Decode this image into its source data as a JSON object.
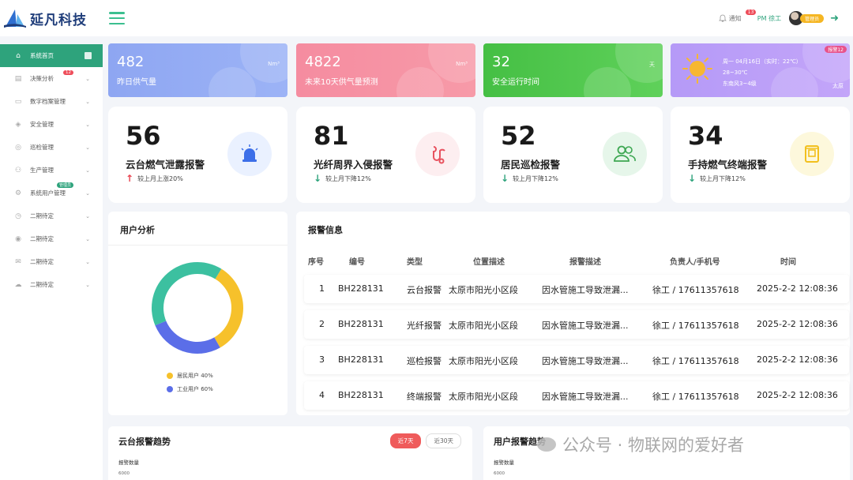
{
  "brand": {
    "name": "延凡科技"
  },
  "header": {
    "notify_label": "通知",
    "notify_count": "13",
    "role": "PM 徐工",
    "user_badge": "管理员"
  },
  "sidebar": {
    "items": [
      {
        "label": "系统首页",
        "icon": "home-icon"
      },
      {
        "label": "决策分析",
        "icon": "chart-icon",
        "count": "12"
      },
      {
        "label": "数字档案管理",
        "icon": "archive-icon"
      },
      {
        "label": "安全管理",
        "icon": "shield-icon"
      },
      {
        "label": "巡检管理",
        "icon": "search-icon"
      },
      {
        "label": "生产管理",
        "icon": "people-icon"
      },
      {
        "label": "系统用户管理",
        "icon": "settings-icon",
        "tag": "管理员"
      },
      {
        "label": "二期待定",
        "icon": "clock-icon"
      },
      {
        "label": "二期待定",
        "icon": "target-icon"
      },
      {
        "label": "二期待定",
        "icon": "mail-icon"
      },
      {
        "label": "二期待定",
        "icon": "cloud-icon"
      }
    ]
  },
  "stats": [
    {
      "value": "482",
      "label": "昨日供气量",
      "unit": "Nm³"
    },
    {
      "value": "4822",
      "label": "未来10天供气量预测",
      "unit": "Nm³"
    },
    {
      "value": "32",
      "label": "安全运行时间",
      "unit": "天"
    }
  ],
  "weather": {
    "line1": "周一 04月16日（实时：22℃）",
    "line2": "28~30℃",
    "line3": "东南风3~4级",
    "city": "太原",
    "badge": "报警12"
  },
  "alarms": [
    {
      "value": "56",
      "name": "云台燃气泄露报警",
      "trend": "较上月上涨20%",
      "dir": "up",
      "icon": "siren-icon"
    },
    {
      "value": "81",
      "name": "光纤周界入侵报警",
      "trend": "较上月下降12%",
      "dir": "down",
      "icon": "fiber-icon"
    },
    {
      "value": "52",
      "name": "居民巡检报警",
      "trend": "较上月下降12%",
      "dir": "down",
      "icon": "users-icon"
    },
    {
      "value": "34",
      "name": "手持燃气终端报警",
      "trend": "较上月下降12%",
      "dir": "down",
      "icon": "terminal-icon"
    }
  ],
  "user_analysis": {
    "title": "用户分析",
    "legend": [
      "居民用户 40%",
      "工业用户 60%"
    ]
  },
  "alarm_table": {
    "title": "报警信息",
    "columns": [
      "序号",
      "编号",
      "类型",
      "位置描述",
      "报警描述",
      "负责人/手机号",
      "时间"
    ],
    "rows": [
      [
        "1",
        "BH228131",
        "云台报警",
        "太原市阳光小区段",
        "因水管施工导致泄漏...",
        "徐工 / 17611357618",
        "2025-2-2 12:08:36"
      ],
      [
        "2",
        "BH228131",
        "光纤报警",
        "太原市阳光小区段",
        "因水管施工导致泄漏...",
        "徐工 / 17611357618",
        "2025-2-2 12:08:36"
      ],
      [
        "3",
        "BH228131",
        "巡检报警",
        "太原市阳光小区段",
        "因水管施工导致泄漏...",
        "徐工 / 17611357618",
        "2025-2-2 12:08:36"
      ],
      [
        "4",
        "BH228131",
        "终端报警",
        "太原市阳光小区段",
        "因水管施工导致泄漏...",
        "徐工 / 17611357618",
        "2025-2-2 12:08:36"
      ]
    ]
  },
  "trend_left": {
    "title": "云台报警趋势",
    "y_label": "报警数量",
    "y_tick": "6000",
    "tabs": [
      "近7天",
      "近30天"
    ]
  },
  "trend_right": {
    "title": "用户报警趋势",
    "y_label": "报警数量",
    "y_tick": "6000"
  },
  "watermark": "公众号 · 物联网的爱好者",
  "chart_data": {
    "type": "pie",
    "categories": [
      "居民用户",
      "工业用户"
    ],
    "values": [
      40,
      60
    ]
  }
}
